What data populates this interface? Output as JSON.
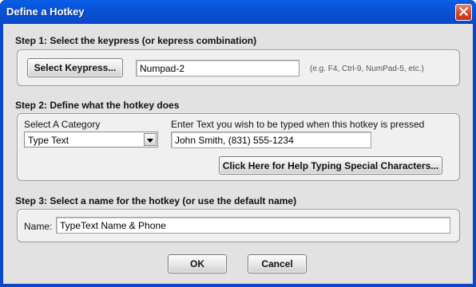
{
  "window": {
    "title": "Define a Hotkey"
  },
  "step1": {
    "title": "Step 1: Select the keypress (or kepress combination)",
    "select_button_label": "Select Keypress...",
    "keypress_value": "Numpad-2",
    "example_hint": "(e.g. F4, Ctrl-9, NumPad-5, etc.)"
  },
  "step2": {
    "title": "Step 2: Define what the hotkey does",
    "category_label": "Select A Category",
    "category_value": "Type Text",
    "text_label": "Enter Text you wish to be typed when this hotkey is pressed",
    "text_value": "John Smith, (831) 555-1234",
    "help_button_label": "Click Here for Help Typing Special Characters..."
  },
  "step3": {
    "title": "Step 3: Select a name for the hotkey (or use the default name)",
    "name_label": "Name:",
    "name_value": "TypeText Name & Phone"
  },
  "footer": {
    "ok_label": "OK",
    "cancel_label": "Cancel"
  },
  "colors": {
    "titlebar": "#0a5fe5",
    "close_button": "#d3472b",
    "dialog_background": "#e2e2e2"
  },
  "icons": {
    "close": "close-icon",
    "dropdown": "chevron-down-icon"
  }
}
